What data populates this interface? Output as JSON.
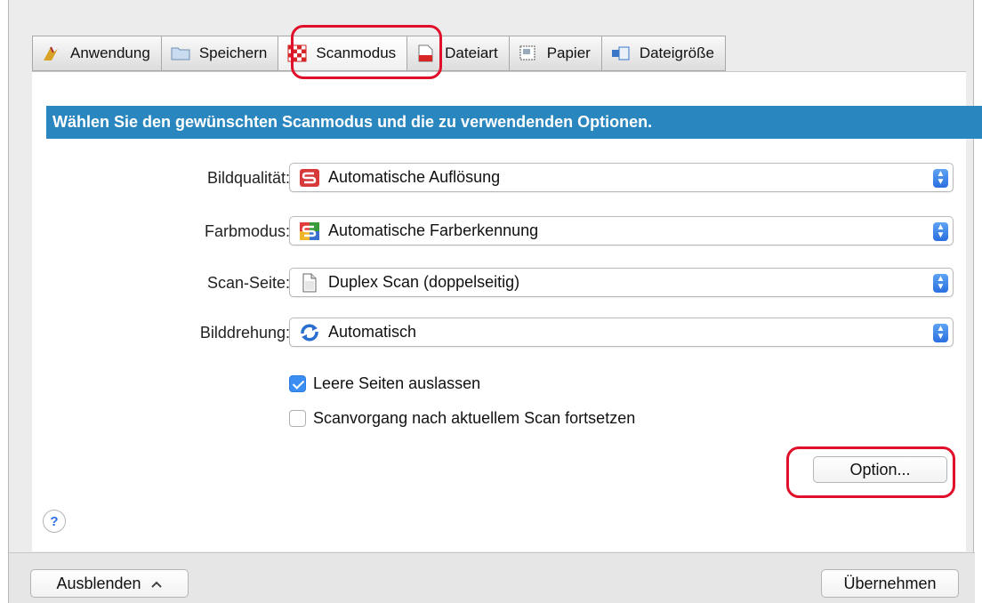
{
  "tabs": [
    {
      "label": "Anwendung",
      "icon": "application-icon"
    },
    {
      "label": "Speichern",
      "icon": "folder-icon"
    },
    {
      "label": "Scanmodus",
      "icon": "scan-mode-icon",
      "active": true
    },
    {
      "label": "Dateiart",
      "icon": "file-type-icon"
    },
    {
      "label": "Papier",
      "icon": "paper-icon"
    },
    {
      "label": "Dateigröße",
      "icon": "file-size-icon"
    }
  ],
  "banner": "Wählen Sie den gewünschten Scanmodus und die zu verwendenden Optionen.",
  "settings": {
    "quality": {
      "label": "Bildqualität:",
      "value": "Automatische Auflösung",
      "icon": "auto-resolution-icon"
    },
    "color": {
      "label": "Farbmodus:",
      "value": "Automatische Farberkennung",
      "icon": "auto-color-icon"
    },
    "side": {
      "label": "Scan-Seite:",
      "value": "Duplex Scan (doppelseitig)",
      "icon": "document-icon"
    },
    "rotation": {
      "label": "Bilddrehung:",
      "value": "Automatisch",
      "icon": "rotate-icon"
    }
  },
  "checkboxes": {
    "skip_blank": {
      "label": "Leere Seiten auslassen",
      "checked": true
    },
    "continue_scan": {
      "label": "Scanvorgang nach aktuellem Scan fortsetzen",
      "checked": false
    }
  },
  "option_button": "Option...",
  "help_label": "?",
  "footer": {
    "hide_button": "Ausblenden",
    "apply_button": "Übernehmen"
  },
  "colors": {
    "banner": "#2a86be",
    "highlight": "#e0102a",
    "checkbox_checked": "#3a8ef3"
  }
}
